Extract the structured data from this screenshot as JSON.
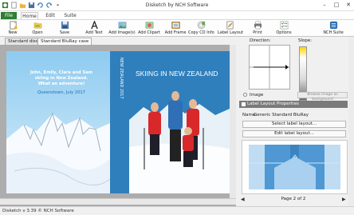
{
  "window": {
    "title": "Disketch by NCH Software"
  },
  "ribbon_tabs": [
    "File",
    "Home",
    "Edit",
    "Suite"
  ],
  "ribbon_buttons": {
    "new": "New",
    "open": "Open",
    "save": "Save",
    "add_text": "Add Text",
    "add_images": "Add Image(s)",
    "add_clipart": "Add Clipart",
    "add_frame": "Add Frame",
    "copy_cd_info": "Copy CD Info",
    "label_layout": "Label Layout",
    "print": "Print",
    "options": "Options",
    "nch_suite": "NCH Suite"
  },
  "doc_tabs": [
    "Standard disc",
    "Standard BluRay case"
  ],
  "label": {
    "back_text": [
      "John, Emily, Clara and Sam",
      "skiing in New Zealand.",
      "What an adventure!"
    ],
    "back_subtext": "Queenstown, July 2017",
    "spine_text": "NEW ZEALAND 2017",
    "front_title": "SKIING IN NEW ZEALAND"
  },
  "panel": {
    "direction_label": "Direction:",
    "slope_label": "Slope:",
    "image_radio_label": "Image",
    "browse_button": "Browse image as background",
    "section_title": "Label Layout Properties",
    "name_label": "Name:",
    "name_value": "Generic Standard BluRay",
    "select_layout_button": "Select label layout...",
    "edit_layout_button": "Edit label layout...",
    "page_indicator": "Page 2 of 2"
  },
  "status": {
    "text": "Disketch v 3.39 © NCH Software"
  },
  "colors": {
    "accent_green": "#2e7d32",
    "case_blue": "#2f7fbc",
    "sky_blue": "#bde0f6"
  }
}
